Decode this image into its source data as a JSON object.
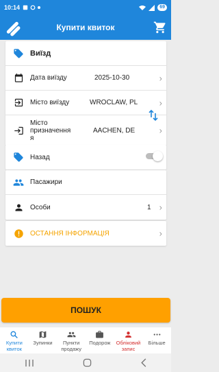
{
  "status": {
    "time": "10:14",
    "battery": "69"
  },
  "header": {
    "title": "Купити квиток"
  },
  "departure": {
    "title": "Виїзд",
    "date_label": "Дата виїзду",
    "date_value": "2025-10-30",
    "from_label": "Місто виїзду",
    "from_value": "WROCLAW, PL",
    "to_label_line1": "Місто",
    "to_label_line2": "призначення",
    "to_label_line3": "я",
    "to_value": "AACHEN, DE"
  },
  "return": {
    "label": "Назад",
    "enabled": false
  },
  "passengers": {
    "title": "Пасажири",
    "persons_label": "Особи",
    "persons_value": "1"
  },
  "info": {
    "label": "ОСТАННЯ ІНФОРМАЦІЯ",
    "color": "#f5a400"
  },
  "pay_button": {
    "label": "ПОШУК",
    "color": "#ffa000"
  },
  "bottom_nav": {
    "buy_line1": "Купити",
    "buy_line2": "квиток",
    "stops": "Зупинки",
    "points_line1": "Пункти",
    "points_line2": "продажу",
    "trip": "Подорож",
    "account_line1": "Обліковий",
    "account_line2": "запис",
    "more": "Більше"
  },
  "colors": {
    "primary": "#1f86db",
    "accent": "#ffa000",
    "account": "#d32f2f"
  }
}
